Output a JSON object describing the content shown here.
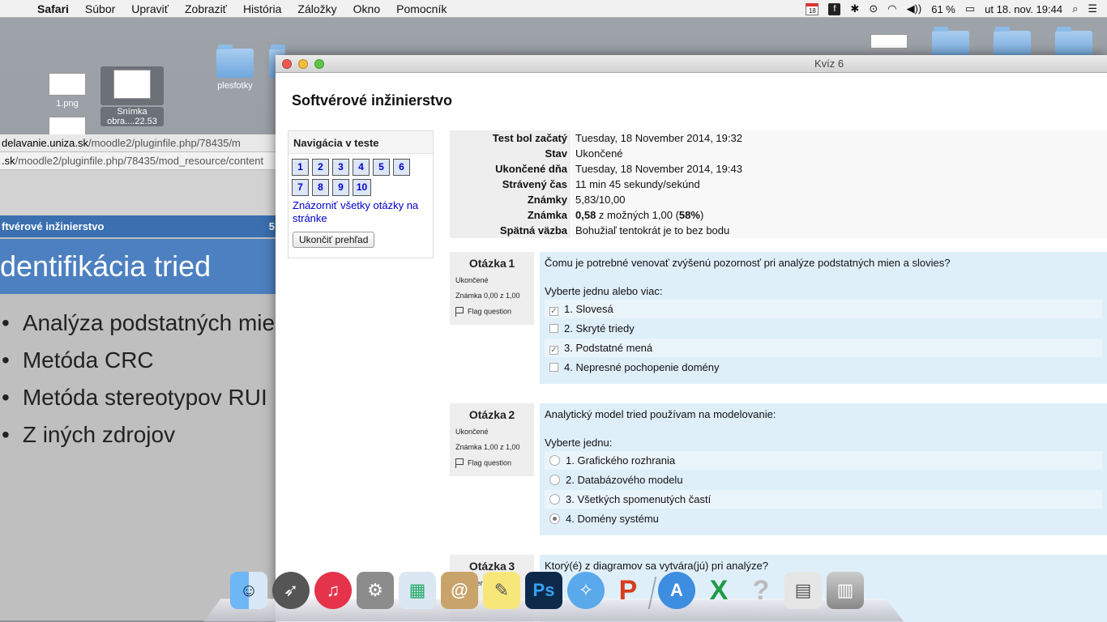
{
  "menubar": {
    "app": "Safari",
    "items": [
      "Súbor",
      "Upraviť",
      "Zobraziť",
      "História",
      "Záložky",
      "Okno",
      "Pomocník"
    ],
    "calendar_day": "18",
    "battery": "61 %",
    "clock": "ut 18. nov.  19:44"
  },
  "desktop": {
    "files": [
      "1.png",
      "Snímka obra....22.53",
      "plesfotky",
      "L"
    ]
  },
  "bg_browser": {
    "url1_prefix": "delavanie.uniza.sk",
    "url1_rest": "/moodle2/pluginfile.php/78435/m",
    "url2_prefix": ".sk",
    "url2_rest": "/moodle2/pluginfile.php/78435/mod_resource/content",
    "slide_strip": "ftvérové inžinierstvo",
    "slide_number": "5",
    "slide_title": "dentifikácia tried",
    "bullets": [
      "Analýza podstatných mie",
      "Metóda CRC",
      "Metóda stereotypov RUI",
      "Z iných zdrojov"
    ]
  },
  "window": {
    "title": "Kvíz 6",
    "page_title": "Softvérové inžinierstvo"
  },
  "nav": {
    "header": "Navigácia v teste",
    "buttons": [
      "1",
      "2",
      "3",
      "4",
      "5",
      "6",
      "7",
      "8",
      "9",
      "10"
    ],
    "show_all_link": "Znázorniť všetky otázky na stránke",
    "end_review": "Ukončiť prehľad"
  },
  "summary": {
    "rows": [
      {
        "label": "Test bol začatý",
        "value": "Tuesday, 18 November 2014, 19:32"
      },
      {
        "label": "Stav",
        "value": "Ukončené"
      },
      {
        "label": "Ukončené dňa",
        "value": "Tuesday, 18 November 2014, 19:43"
      },
      {
        "label": "Strávený čas",
        "value": "11 min 45 sekundy/sekúnd"
      },
      {
        "label": "Známky",
        "value": "5,83/10,00"
      },
      {
        "label": "Známka",
        "value_bold1": "0,58",
        "value_mid": " z možných 1,00 (",
        "value_bold2": "58%",
        "value_end": ")"
      },
      {
        "label": "Spätná väzba",
        "value": "Bohužiaľ tentokrát je to bez bodu"
      }
    ]
  },
  "questions": [
    {
      "label": "Otázka",
      "number": "1",
      "state": "Ukončené",
      "grade": "Známka 0,00 z 1,00",
      "flag": "Flag question",
      "text": "Čomu je potrebné venovať zvýšenú pozornosť pri analýze podstatných mien a slovies?",
      "prompt": "Vyberte jednu alebo viac:",
      "options": [
        "1. Slovesá",
        "2. Skryté triedy",
        "3. Podstatné mená",
        "4. Nepresné pochopenie domény"
      ],
      "checked": [
        true,
        false,
        true,
        false
      ]
    },
    {
      "label": "Otázka",
      "number": "2",
      "state": "Ukončené",
      "grade": "Známka 1,00 z 1,00",
      "flag": "Flag question",
      "text": "Analytický model tried používam na modelovanie:",
      "prompt": "Vyberte jednu:",
      "options": [
        "1. Grafického rozhrania",
        "2. Databázového modelu",
        "3. Všetkých spomenutých častí",
        "4. Domény systému"
      ],
      "checked": [
        false,
        false,
        false,
        true
      ]
    },
    {
      "label": "Otázka",
      "number": "3",
      "state": "Ukončené",
      "text": "Ktorý(é) z diagramov sa vytvára(jú) pri analýze?"
    }
  ]
}
